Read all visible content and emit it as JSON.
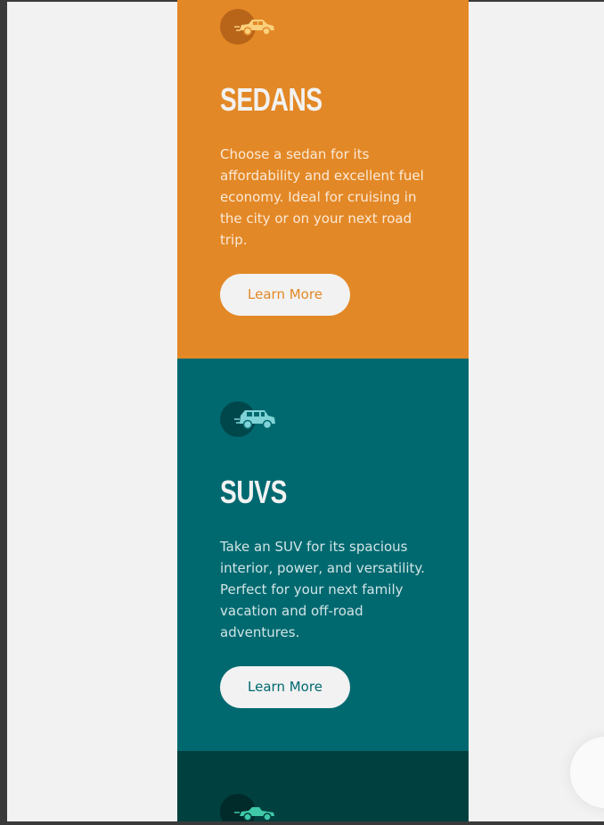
{
  "cards": [
    {
      "id": "sedans",
      "icon": "sedan-icon",
      "title": "SEDANS",
      "text": "Choose a sedan for its affordability and excellent fuel economy. Ideal for cruising in the city or on your next road trip.",
      "button_label": "Learn More",
      "background": "#e38826"
    },
    {
      "id": "suvs",
      "icon": "suv-icon",
      "title": "SUVS",
      "text": "Take an SUV for its spacious interior, power, and versatility. Perfect for your next family vacation and off-road adventures.",
      "button_label": "Learn More",
      "background": "#006970"
    },
    {
      "id": "luxury",
      "icon": "luxury-car-icon",
      "background": "#004140"
    }
  ],
  "colors": {
    "page_background": "#f2f2f2",
    "sedans_accent": "#e38826",
    "suvs_accent": "#006970",
    "luxury_accent": "#004140",
    "button_background": "#f2f2f2",
    "heading_text": "#f2f2f2"
  }
}
